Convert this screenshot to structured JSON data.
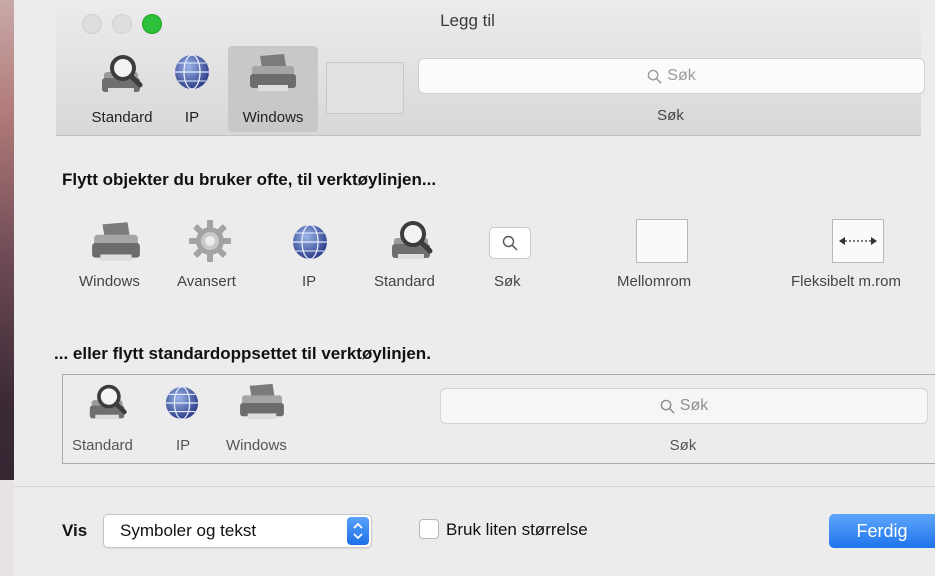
{
  "window": {
    "title": "Legg til"
  },
  "toolbar": {
    "items": [
      {
        "label": "Standard",
        "icon": "standard-printer-magnifier-icon"
      },
      {
        "label": "IP",
        "icon": "globe-icon"
      },
      {
        "label": "Windows",
        "icon": "windows-printer-icon",
        "selected": true
      }
    ],
    "search": {
      "placeholder": "Søk",
      "label": "Søk"
    }
  },
  "customize": {
    "heading": "Flytt objekter du bruker ofte, til verktøylinjen...",
    "palette": [
      {
        "label": "Windows",
        "icon": "printer-icon"
      },
      {
        "label": "Avansert",
        "icon": "gear-icon"
      },
      {
        "label": "IP",
        "icon": "globe-icon"
      },
      {
        "label": "Standard",
        "icon": "printer-magnifier-icon"
      },
      {
        "label": "Søk",
        "icon": "search-icon"
      },
      {
        "label": "Mellomrom",
        "icon": "space-icon"
      },
      {
        "label": "Fleksibelt m.rom",
        "icon": "flexible-space-icon"
      }
    ],
    "default_heading": "... eller flytt standardoppsettet til verktøylinjen.",
    "default_set": {
      "items": [
        {
          "label": "Standard"
        },
        {
          "label": "IP"
        },
        {
          "label": "Windows"
        }
      ],
      "search": {
        "placeholder": "Søk",
        "label": "Søk"
      }
    }
  },
  "footer": {
    "show_label": "Vis",
    "show_value": "Symboler og tekst",
    "small_size_label": "Bruk liten størrelse",
    "small_size_checked": false,
    "done_label": "Ferdig"
  },
  "colors": {
    "accent": "#1f74ec",
    "zoom": "#2dc23b"
  }
}
